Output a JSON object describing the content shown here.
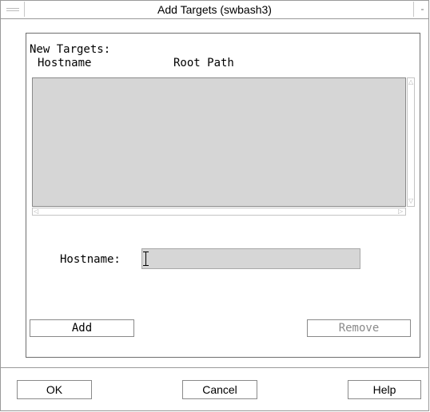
{
  "window": {
    "title": "Add Targets (swbash3)"
  },
  "target_list": {
    "title": "New Targets:",
    "columns": [
      "Hostname",
      "Root Path"
    ],
    "rows": []
  },
  "hostname_field": {
    "label": "Hostname:",
    "value": ""
  },
  "group_buttons": {
    "add_label": "Add",
    "remove_label": "Remove",
    "remove_enabled": false
  },
  "dialog_buttons": {
    "ok_label": "OK",
    "cancel_label": "Cancel",
    "help_label": "Help"
  },
  "colors": {
    "list_background": "#d6d6d6",
    "input_background": "#d6d6d6",
    "disabled_text": "#8a8a8a"
  },
  "icons": [
    "window-menu-icon",
    "window-minimize-icon",
    "scroll-up-arrow-icon",
    "scroll-down-arrow-icon",
    "scroll-left-arrow-icon",
    "scroll-right-arrow-icon",
    "text-cursor-icon"
  ]
}
